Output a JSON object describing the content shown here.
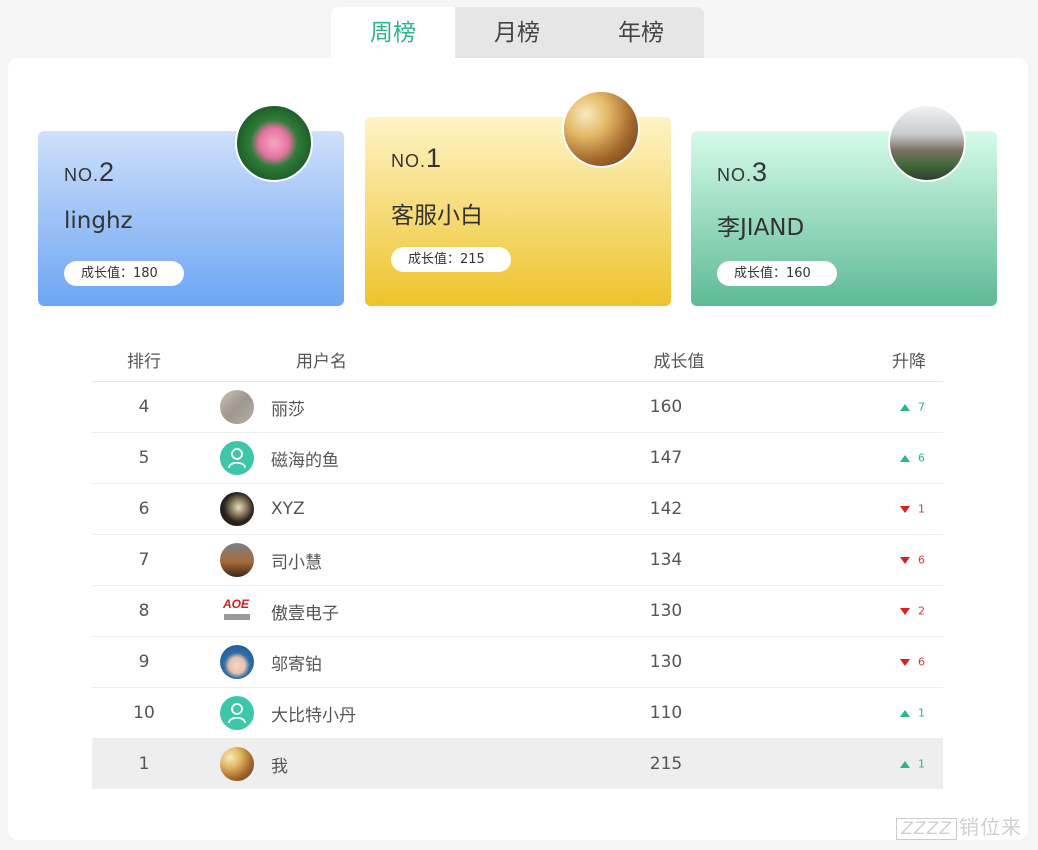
{
  "tabs": [
    {
      "label": "周榜",
      "active": true
    },
    {
      "label": "月榜",
      "active": false
    },
    {
      "label": "年榜",
      "active": false
    }
  ],
  "podium": [
    {
      "place_prefix": "NO.",
      "place": "2",
      "name": "linghz",
      "growth": "成长值：180",
      "avatar": "lotus-avatar"
    },
    {
      "place_prefix": "NO.",
      "place": "1",
      "name": "客服小白",
      "growth": "成长值：215",
      "avatar": "hat-avatar"
    },
    {
      "place_prefix": "NO.",
      "place": "3",
      "name": "李JIAND",
      "growth": "成长值：160",
      "avatar": "city-avatar"
    }
  ],
  "table": {
    "headers": {
      "rank": "排行",
      "user": "用户名",
      "growth": "成长值",
      "trend": "升降"
    },
    "rows": [
      {
        "rank": "4",
        "name": "丽莎",
        "growth": "160",
        "trend": "up",
        "change": "7",
        "avatar": "sand-avatar"
      },
      {
        "rank": "5",
        "name": "磁海的鱼",
        "growth": "147",
        "trend": "up",
        "change": "6",
        "avatar": "default-user-avatar"
      },
      {
        "rank": "6",
        "name": "XYZ",
        "growth": "142",
        "trend": "down",
        "change": "1",
        "avatar": "moon-avatar"
      },
      {
        "rank": "7",
        "name": "司小慧",
        "growth": "134",
        "trend": "down",
        "change": "6",
        "avatar": "dusk-avatar"
      },
      {
        "rank": "8",
        "name": "傲壹电子",
        "growth": "130",
        "trend": "down",
        "change": "2",
        "avatar": "aoe-logo-avatar"
      },
      {
        "rank": "9",
        "name": "邬寄铂",
        "growth": "130",
        "trend": "down",
        "change": "6",
        "avatar": "man-avatar"
      },
      {
        "rank": "10",
        "name": "大比特小丹",
        "growth": "110",
        "trend": "up",
        "change": "1",
        "avatar": "default-user-avatar"
      }
    ],
    "me": {
      "rank": "1",
      "name": "我",
      "growth": "215",
      "trend": "up",
      "change": "1",
      "avatar": "hat-avatar"
    }
  },
  "watermark": {
    "box": "ZZZZ",
    "text": "销位来"
  },
  "colors": {
    "accent": "#2fb38d",
    "down": "#d92020"
  }
}
